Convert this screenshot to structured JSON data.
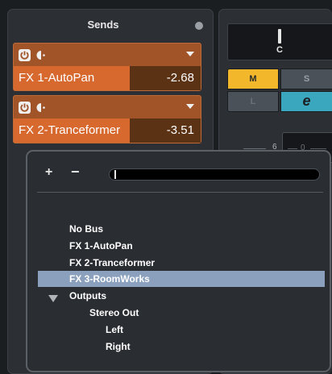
{
  "sends": {
    "title": "Sends",
    "slots": [
      {
        "name": "FX 1-AutoPan",
        "value": "-2.68",
        "level": 0.62
      },
      {
        "name": "FX 2-Tranceformer",
        "value": "-3.51",
        "level": 0.62
      }
    ]
  },
  "mixer": {
    "pan_label": "C",
    "mute_label": "M",
    "solo_label": "S",
    "listen_label": "L",
    "edit_label": "e",
    "fader_scale_value": "6",
    "fader_box_value": "0"
  },
  "routing_popup": {
    "add_label": "+",
    "remove_label": "−",
    "items": [
      {
        "label": "No Bus"
      },
      {
        "label": "FX 1-AutoPan"
      },
      {
        "label": "FX 2-Tranceformer"
      },
      {
        "label": "FX 3-RoomWorks",
        "selected": true
      },
      {
        "label": "Outputs",
        "expanded": true
      },
      {
        "label": "Stereo Out"
      },
      {
        "label": "Left"
      },
      {
        "label": "Right"
      }
    ]
  },
  "colors": {
    "send_active": "#d7692f",
    "mute_active": "#f2b72b",
    "edit_active": "#3aa7bf",
    "selection": "#8aa0bd"
  }
}
